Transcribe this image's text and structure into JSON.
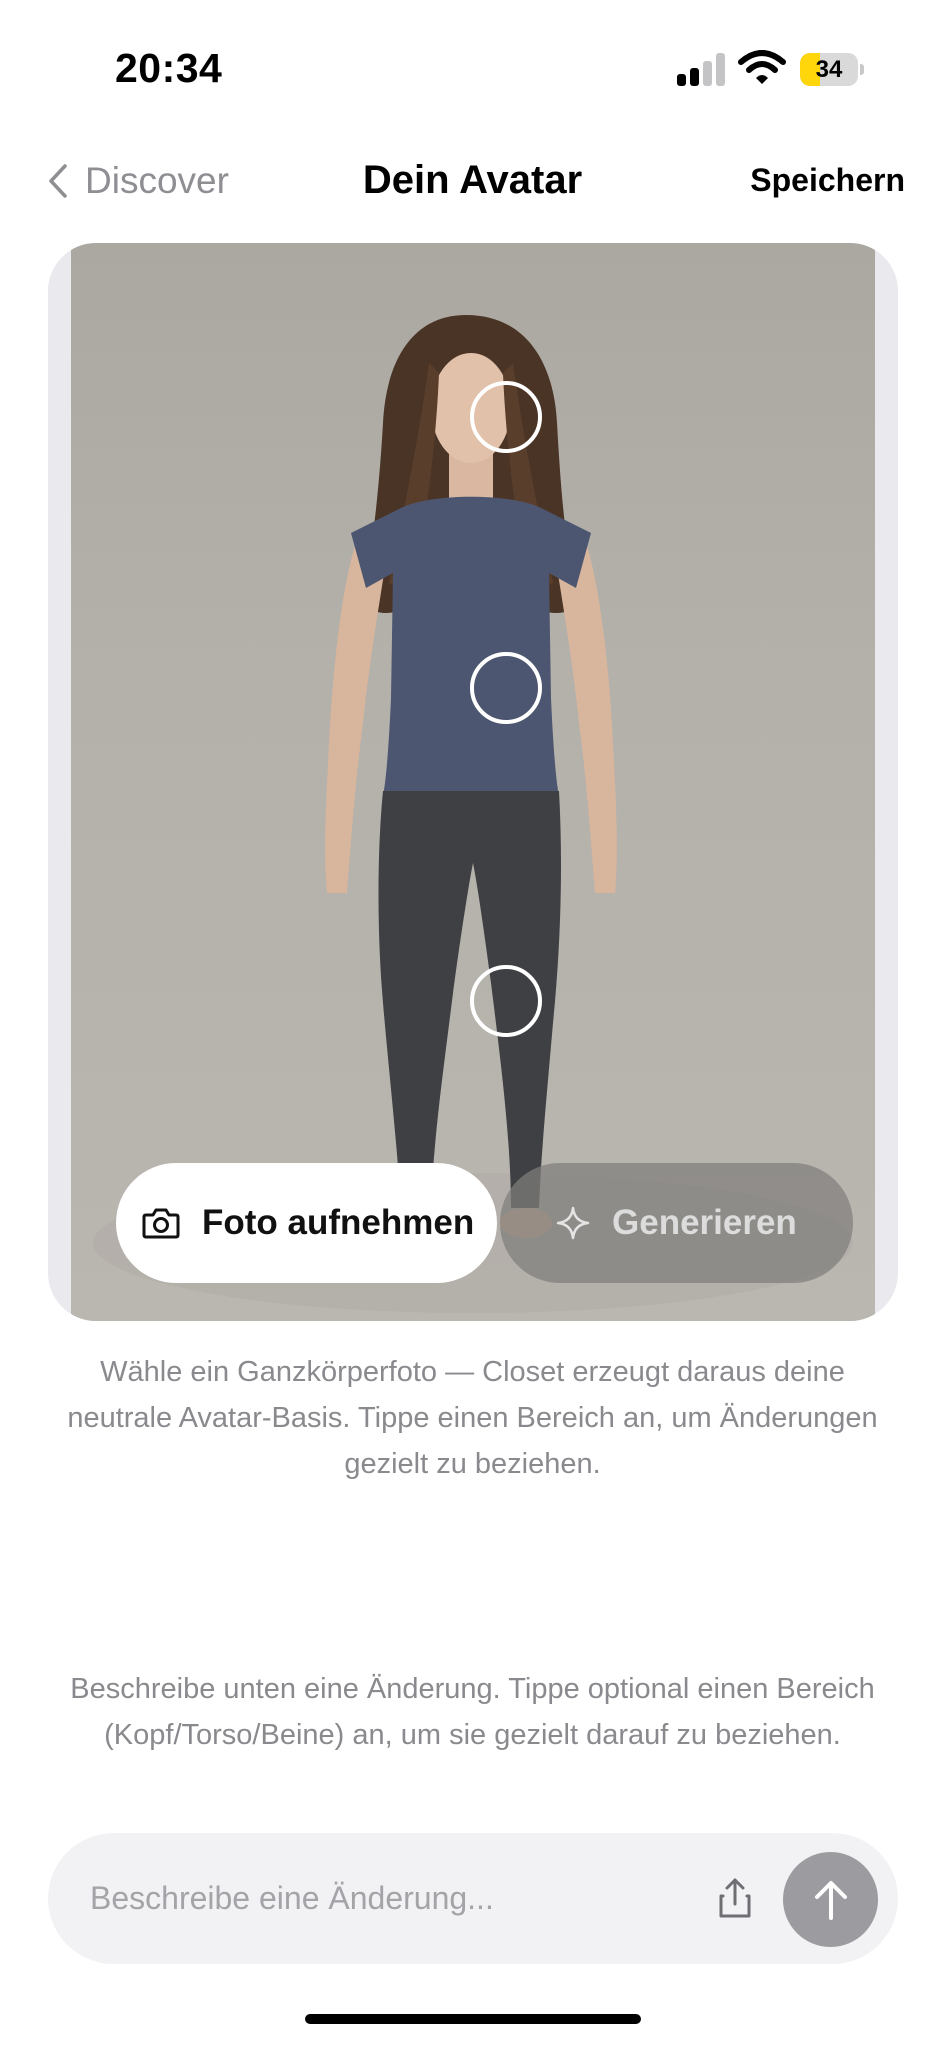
{
  "status_bar": {
    "time": "20:34",
    "battery_level": "34",
    "battery_fraction": 0.34,
    "signal_bars_active": 2,
    "signal_bars_total": 4,
    "icons": [
      "cellular-signal-icon",
      "wifi-icon",
      "battery-icon"
    ]
  },
  "nav": {
    "back_label": "Discover",
    "title": "Dein Avatar",
    "save_label": "Speichern"
  },
  "avatar_card": {
    "photo_label": "Foto aufnehmen",
    "generate_label": "Generieren",
    "regions": [
      "head",
      "torso",
      "legs"
    ],
    "icons": {
      "photo": "camera-icon",
      "generate": "sparkle-icon"
    }
  },
  "hints": {
    "photo_hint": "Wähle ein Ganzkörperfoto — Closet erzeugt daraus deine neutrale Avatar-Basis. Tippe einen Bereich an, um Änderungen gezielt zu beziehen.",
    "change_hint": "Beschreibe unten eine Änderung. Tippe optional einen Bereich (Kopf/Torso/Beine) an, um sie gezielt darauf zu beziehen."
  },
  "composer": {
    "placeholder": "Beschreibe eine Änderung...",
    "value": "",
    "icons": {
      "upload": "share-upload-icon",
      "send": "arrow-up-icon"
    }
  },
  "colors": {
    "accent_battery": "#ffd60a",
    "secondary_text": "#8a8a8e",
    "send_button": "#9c9ca0",
    "composer_bg": "#f2f2f5"
  }
}
